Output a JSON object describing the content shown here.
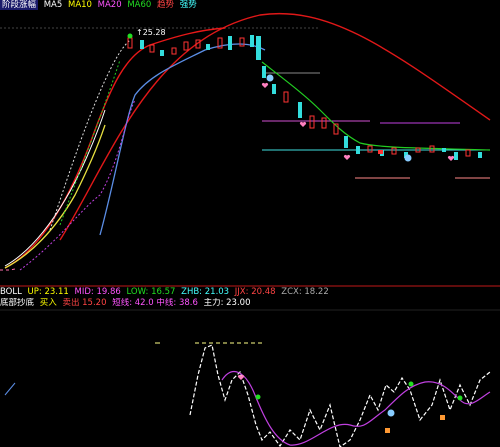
{
  "colors": {
    "background": "#000000",
    "ma_red": "#e01818",
    "ma_blue": "#5b8ee6",
    "ma_white": "#ffffff",
    "ma_yellow": "#e8e040",
    "ma_green": "#22cc22",
    "ma_magenta": "#c040e0",
    "candle_up": "#ff3333",
    "candle_down": "#33dddd",
    "divider": "#c01818"
  },
  "top_bar": {
    "title": "阶段涨幅",
    "items": [
      {
        "text": "MA5",
        "color": "w"
      },
      {
        "text": "MA10",
        "color": "y"
      },
      {
        "text": "MA20",
        "color": "m"
      },
      {
        "text": "MA60",
        "color": "g"
      },
      {
        "text": "趋势",
        "color": "r"
      },
      {
        "text": "强势",
        "color": "c"
      }
    ]
  },
  "price_label": "↑25.28",
  "mid_bar": {
    "items": [
      {
        "text": "BOLL",
        "color": "w"
      },
      {
        "text": "UP: 23.11",
        "color": "y"
      },
      {
        "text": "MID: 19.86",
        "color": "m"
      },
      {
        "text": "LOW: 16.57",
        "color": "g"
      },
      {
        "text": "ZHB: 21.03",
        "color": "c"
      },
      {
        "text": "JJX: 20.48",
        "color": "r"
      },
      {
        "text": "ZCX: 18.22",
        "color": "gr"
      }
    ]
  },
  "sub_bar": {
    "items": [
      {
        "text": "底部抄底",
        "color": "w"
      },
      {
        "text": "买入",
        "color": "y"
      },
      {
        "text": "卖出 15.20",
        "color": "r"
      },
      {
        "text": "短线: 42.0 中线: 38.6",
        "color": "m"
      },
      {
        "text": "主力: 23.00",
        "color": "w"
      }
    ]
  }
}
